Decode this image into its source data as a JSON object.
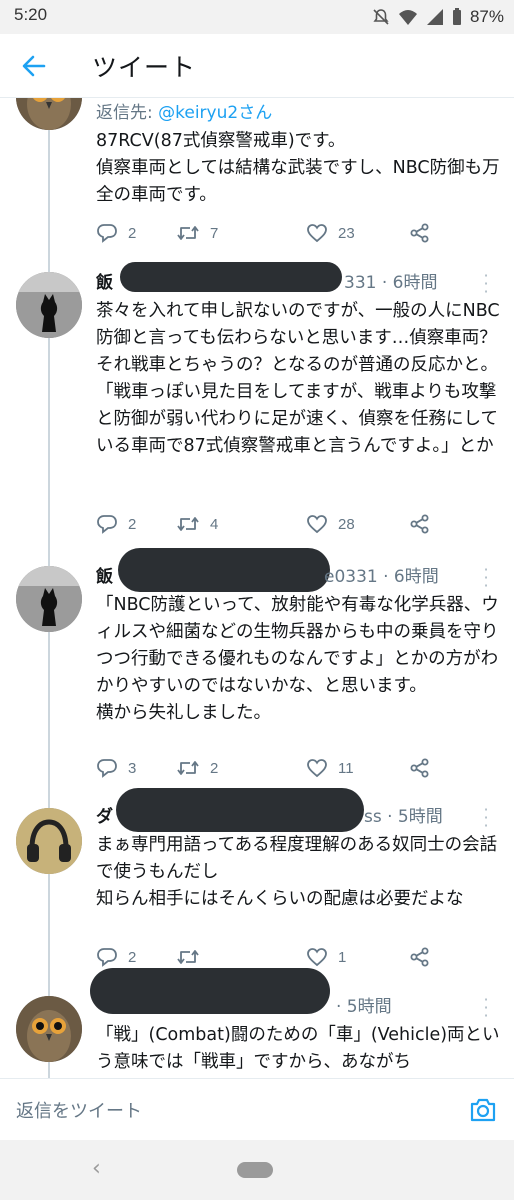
{
  "status_bar": {
    "time": "5:20",
    "battery": "87%"
  },
  "app_bar": {
    "title": "ツイート",
    "back_icon": "arrow-left-icon"
  },
  "colors": {
    "accent": "#1da1f2",
    "text": "#14171a",
    "muted": "#657786",
    "redaction": "#2b2f33"
  },
  "tweets": [
    {
      "reply_to_label": "返信先: ",
      "reply_to_handle": "@keiryu2さん",
      "text": "87RCV(87式偵察警戒車)です。\n偵察車両としては結構な武装ですし、NBC防御も万全の車両です。",
      "replies": "2",
      "retweets": "7",
      "likes": "23"
    },
    {
      "name_start": "飯",
      "handle_tail": "331 · 6時間",
      "text": "茶々を入れて申し訳ないのですが、一般の人にNBC防御と言っても伝わらないと思います…偵察車両？それ戦車とちゃうの？となるのが普通の反応かと。\n「戦車っぽい見た目をしてますが、戦車よりも攻撃と防御が弱い代わりに足が速く、偵察を任務にしている車両で87式偵察警戒車と言うんですよ。」とか",
      "replies": "2",
      "retweets": "4",
      "likes": "28"
    },
    {
      "name_start": "飯",
      "handle_tail": "e0331 · 6時間",
      "text": "「NBC防護といって、放射能や有毒な化学兵器、ウィルスや細菌などの生物兵器からも中の乗員を守りつつ行動できる優れものなんですよ」とかの方がわかりやすいのではないかな、と思います。\n横から失礼しました。",
      "replies": "3",
      "retweets": "2",
      "likes": "11"
    },
    {
      "name_start": "ダ",
      "handle_tail": "ss · 5時間",
      "text": "まぁ専門用語ってある程度理解のある奴同士の会話で使うもんだし\n知らん相手にはそんくらいの配慮は必要だよな",
      "replies": "2",
      "retweets": "",
      "likes": "1"
    },
    {
      "name_start": "",
      "handle_tail": "· 5時間",
      "text": "「戦」(Combat)闘のための「車」(Vehicle)両という意味では「戦車」ですから、あながち"
    }
  ],
  "compose": {
    "placeholder": "返信をツイート"
  }
}
